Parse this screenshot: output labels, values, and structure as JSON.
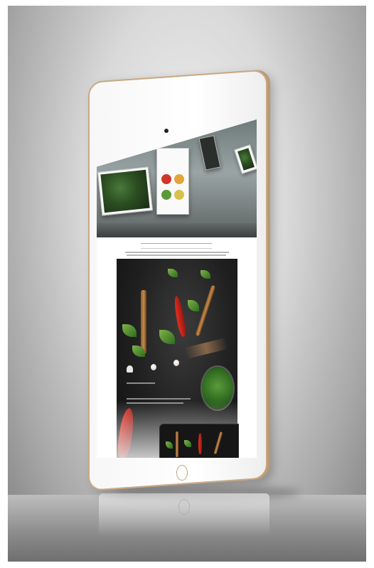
{
  "scene": {
    "subject": "tablet-mockup",
    "colors": {
      "background": "#d9d9d9",
      "tablet_bezel": "#ffffff",
      "tablet_trim": "#c9a883",
      "poster_dark": "#1f1f1f",
      "leaf_green": "#4a7a3a",
      "chili_red": "#e03020"
    }
  }
}
